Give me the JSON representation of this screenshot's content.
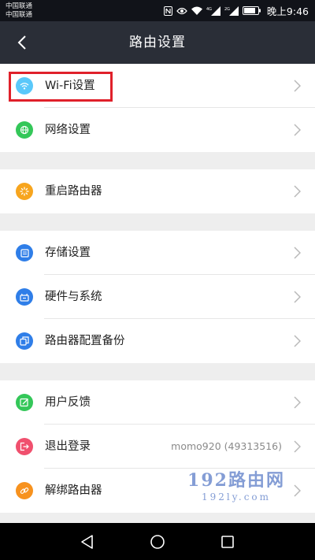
{
  "status_bar": {
    "carrier_1": "中国联通",
    "carrier_2": "中国联通",
    "icons": [
      "nfc-icon",
      "eye-icon",
      "wifi-icon",
      "4g-signal-icon",
      "2g-signal-icon",
      "battery-icon"
    ],
    "network_1": "4G",
    "network_2": "2G",
    "time": "晚上9:46"
  },
  "header": {
    "title": "路由设置",
    "back_icon": "back-arrow-icon"
  },
  "groups": [
    {
      "items": [
        {
          "label": "Wi-Fi设置",
          "icon": "wifi-icon",
          "icon_color": "#5ac8fa",
          "highlighted": true
        },
        {
          "label": "网络设置",
          "icon": "globe-icon",
          "icon_color": "#34c759"
        }
      ]
    },
    {
      "items": [
        {
          "label": "重启路由器",
          "icon": "restart-icon",
          "icon_color": "#f7a51e"
        }
      ]
    },
    {
      "items": [
        {
          "label": "存储设置",
          "icon": "storage-icon",
          "icon_color": "#2f7ee8"
        },
        {
          "label": "硬件与系统",
          "icon": "hardware-icon",
          "icon_color": "#2f7ee8"
        },
        {
          "label": "路由器配置备份",
          "icon": "backup-icon",
          "icon_color": "#2f7ee8"
        }
      ]
    },
    {
      "items": [
        {
          "label": "用户反馈",
          "icon": "feedback-icon",
          "icon_color": "#34c759"
        },
        {
          "label": "退出登录",
          "icon": "logout-icon",
          "icon_color": "#f0506e",
          "value": "momo920 (49313516)"
        },
        {
          "label": "解绑路由器",
          "icon": "unlink-icon",
          "icon_color": "#f7921e"
        }
      ]
    }
  ],
  "highlight_color": "#e0202a",
  "watermark": {
    "main": "192路由网",
    "sub": "192ly.com"
  },
  "nav_bar": {
    "icons": [
      "back-triangle-icon",
      "home-circle-icon",
      "recents-square-icon"
    ]
  }
}
